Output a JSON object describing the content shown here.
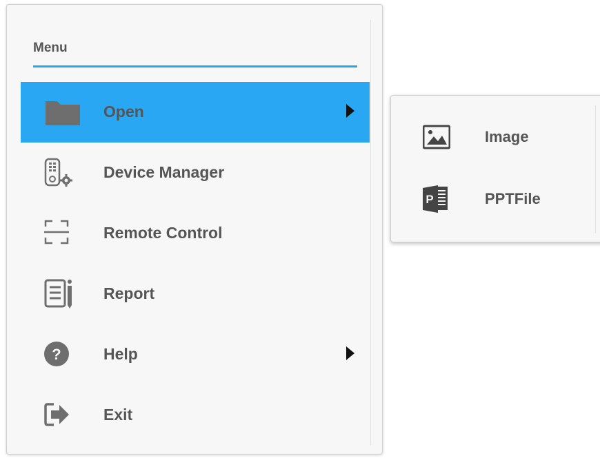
{
  "menu": {
    "title": "Menu",
    "accent_color": "#1fa6ec",
    "active_color": "#2aa7f2",
    "items": [
      {
        "label": "Open",
        "icon": "folder-icon",
        "has_submenu": true,
        "active": true
      },
      {
        "label": "Device Manager",
        "icon": "device-manager-icon",
        "has_submenu": false
      },
      {
        "label": "Remote Control",
        "icon": "remote-control-icon",
        "has_submenu": false
      },
      {
        "label": "Report",
        "icon": "report-icon",
        "has_submenu": false
      },
      {
        "label": "Help",
        "icon": "help-icon",
        "has_submenu": true
      },
      {
        "label": "Exit",
        "icon": "exit-icon",
        "has_submenu": false
      }
    ]
  },
  "submenu": {
    "items": [
      {
        "label": "Image",
        "icon": "image-icon"
      },
      {
        "label": "PPTFile",
        "icon": "ppt-file-icon"
      }
    ]
  }
}
